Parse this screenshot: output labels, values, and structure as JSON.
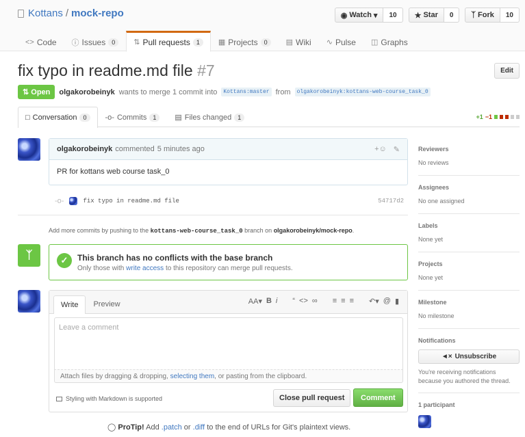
{
  "repo": {
    "owner": "Kottans",
    "separator": "/",
    "name": "mock-repo"
  },
  "actions": {
    "watch": {
      "label": "Watch",
      "count": "10"
    },
    "star": {
      "label": "Star",
      "count": "0"
    },
    "fork": {
      "label": "Fork",
      "count": "10"
    }
  },
  "tabs": [
    {
      "label": "Code",
      "count": ""
    },
    {
      "label": "Issues",
      "count": "0"
    },
    {
      "label": "Pull requests",
      "count": "1"
    },
    {
      "label": "Projects",
      "count": "0"
    },
    {
      "label": "Wiki",
      "count": ""
    },
    {
      "label": "Pulse",
      "count": ""
    },
    {
      "label": "Graphs",
      "count": ""
    }
  ],
  "pr": {
    "title": "fix typo in readme.md file",
    "number": "#7",
    "edit": "Edit",
    "state": "Open",
    "author": "olgakorobeinyk",
    "merge_text": "wants to merge 1 commit into",
    "base": "Kottans:master",
    "from": "from",
    "head": "olgakorobeinyk:kottans-web-course_task_0"
  },
  "pr_tabs": [
    {
      "label": "Conversation",
      "count": "0"
    },
    {
      "label": "Commits",
      "count": "1"
    },
    {
      "label": "Files changed",
      "count": "1"
    }
  ],
  "diffstat": {
    "add": "+1",
    "del": "−1"
  },
  "comment": {
    "author": "olgakorobeinyk",
    "action": "commented",
    "time": "5 minutes ago",
    "body": "PR for kottans web course task_0"
  },
  "commit": {
    "message": "fix typo in readme.md file",
    "sha": "54717d2"
  },
  "add_more": {
    "prefix": "Add more commits by pushing to the",
    "branch": "kottans-web-course_task_0",
    "mid": "branch on",
    "repo": "olgakorobeinyk/mock-repo",
    "suffix": "."
  },
  "merge": {
    "title": "This branch has no conflicts with the base branch",
    "sub_prefix": "Only those with",
    "sub_link": "write access",
    "sub_suffix": "to this repository can merge pull requests."
  },
  "new_comment": {
    "write": "Write",
    "preview": "Preview",
    "placeholder": "Leave a comment",
    "attach_prefix": "Attach files by dragging & dropping,",
    "attach_link": "selecting them",
    "attach_suffix": ", or pasting from the clipboard.",
    "markdown": "Styling with Markdown is supported",
    "close": "Close pull request",
    "submit": "Comment"
  },
  "protip": {
    "label": "ProTip!",
    "a": "Add",
    "patch": ".patch",
    "or": "or",
    "diff": ".diff",
    "rest": "to the end of URLs for Git's plaintext views."
  },
  "sidebar": {
    "reviewers": {
      "h": "Reviewers",
      "v": "No reviews"
    },
    "assignees": {
      "h": "Assignees",
      "v": "No one assigned"
    },
    "labels": {
      "h": "Labels",
      "v": "None yet"
    },
    "projects": {
      "h": "Projects",
      "v": "None yet"
    },
    "milestone": {
      "h": "Milestone",
      "v": "No milestone"
    },
    "notifications": {
      "h": "Notifications",
      "button": "Unsubscribe",
      "note": "You're receiving notifications because you authored the thread."
    },
    "participants": {
      "h": "1 participant"
    }
  },
  "colors": {
    "open": "#6cc644",
    "link": "#4078c0",
    "tab_accent": "#d26911"
  }
}
